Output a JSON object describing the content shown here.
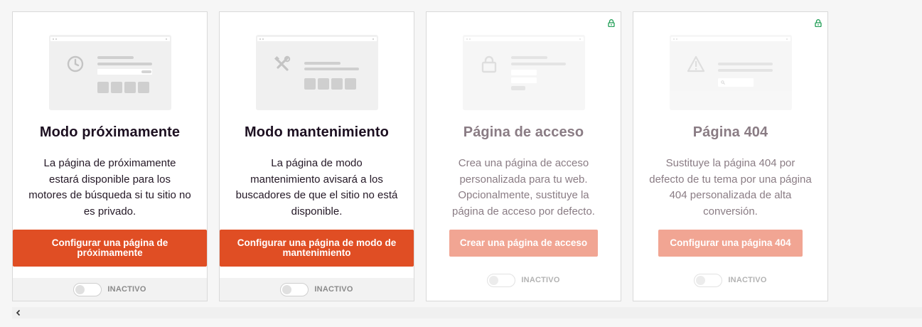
{
  "cards": [
    {
      "title": "Modo próximamente",
      "description": "La página de próximamente estará disponible para los motores de búsqueda si tu sitio no es privado.",
      "button_label": "Configurar una página de próximamente",
      "status": "INACTIVO",
      "locked": false,
      "preview_icon": "clock-icon"
    },
    {
      "title": "Modo mantenimiento",
      "description": "La página de modo mantenimiento avisará a los buscadores de que el sitio no está disponible.",
      "button_label": "Configurar una página de modo de mantenimiento",
      "status": "INACTIVO",
      "locked": false,
      "preview_icon": "tools-icon"
    },
    {
      "title": "Página de acceso",
      "description": "Crea una página de acceso personalizada para tu web. Opcionalmente, sustituye la página de acceso por defecto.",
      "button_label": "Crear una página de acceso",
      "status": "INACTIVO",
      "locked": true,
      "preview_icon": "padlock-icon"
    },
    {
      "title": "Página 404",
      "description": "Sustituye la página 404 por defecto de tu tema por una página 404 personalizada de alta conversión.",
      "button_label": "Configurar una página 404",
      "status": "INACTIVO",
      "locked": true,
      "preview_icon": "warning-icon"
    }
  ],
  "colors": {
    "accent": "#e04e24",
    "accent_disabled": "#f1a593",
    "title_active": "#1d1021",
    "title_locked": "#8a7c84",
    "lock_green": "#1f9d55"
  },
  "icons": {
    "lock_badge": "lock-icon",
    "scroll_left": "chevron-left-icon"
  }
}
